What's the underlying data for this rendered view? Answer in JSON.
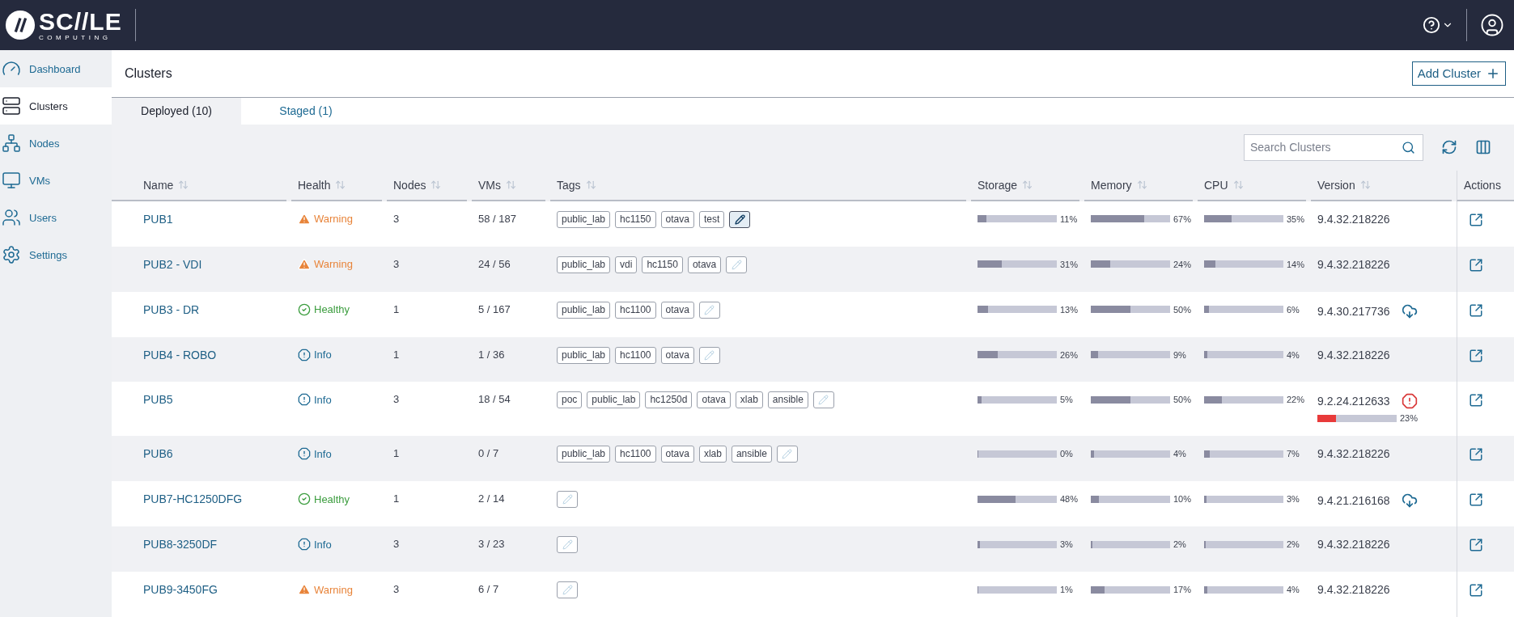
{
  "logo": {
    "name": "SC//LE",
    "tagline": "COMPUTING"
  },
  "sidebar": {
    "items": [
      {
        "label": "Dashboard",
        "selected": false
      },
      {
        "label": "Clusters",
        "selected": true
      },
      {
        "label": "Nodes",
        "selected": false
      },
      {
        "label": "VMs",
        "selected": false
      },
      {
        "label": "Users",
        "selected": false
      },
      {
        "label": "Settings",
        "selected": false
      }
    ]
  },
  "page": {
    "title": "Clusters",
    "add_button": "Add Cluster"
  },
  "tabs": [
    {
      "label": "Deployed (10)",
      "selected": true
    },
    {
      "label": "Staged (1)",
      "selected": false
    }
  ],
  "search": {
    "placeholder": "Search Clusters"
  },
  "table": {
    "columns": [
      {
        "label": "Name",
        "sortable": true
      },
      {
        "label": "Health",
        "sortable": true
      },
      {
        "label": "Nodes",
        "sortable": true
      },
      {
        "label": "VMs",
        "sortable": true
      },
      {
        "label": "Tags",
        "sortable": true
      },
      {
        "label": "Storage",
        "sortable": true
      },
      {
        "label": "Memory",
        "sortable": true
      },
      {
        "label": "CPU",
        "sortable": true
      },
      {
        "label": "Version",
        "sortable": true
      },
      {
        "label": "Actions",
        "sortable": false
      }
    ],
    "rows": [
      {
        "name": "PUB1",
        "health": {
          "kind": "warning",
          "label": "Warning"
        },
        "nodes": "3",
        "vms": "58 / 187",
        "tags": [
          "public_lab",
          "hc1150",
          "otava",
          "test"
        ],
        "edit_highlighted": true,
        "storage": {
          "level": 0.11,
          "reading": "11%"
        },
        "memory": {
          "level": 0.67,
          "reading": "67%"
        },
        "cpu": {
          "level": 0.35,
          "reading": "35%"
        },
        "version": {
          "text": "9.4.32.218226",
          "kind": "plain"
        }
      },
      {
        "name": "PUB2 - VDI",
        "health": {
          "kind": "warning",
          "label": "Warning"
        },
        "nodes": "3",
        "vms": "24 / 56",
        "tags": [
          "public_lab",
          "vdi",
          "hc1150",
          "otava"
        ],
        "edit_highlighted": false,
        "storage": {
          "level": 0.31,
          "reading": "31%"
        },
        "memory": {
          "level": 0.24,
          "reading": "24%"
        },
        "cpu": {
          "level": 0.14,
          "reading": "14%"
        },
        "version": {
          "text": "9.4.32.218226",
          "kind": "plain"
        }
      },
      {
        "name": "PUB3 - DR",
        "health": {
          "kind": "healthy",
          "label": "Healthy"
        },
        "nodes": "1",
        "vms": "5 / 167",
        "tags": [
          "public_lab",
          "hc1100",
          "otava"
        ],
        "edit_highlighted": false,
        "storage": {
          "level": 0.13,
          "reading": "13%"
        },
        "memory": {
          "level": 0.5,
          "reading": "50%"
        },
        "cpu": {
          "level": 0.06,
          "reading": "6%"
        },
        "version": {
          "text": "9.4.30.217736",
          "kind": "update"
        }
      },
      {
        "name": "PUB4 - ROBO",
        "health": {
          "kind": "info",
          "label": "Info"
        },
        "nodes": "1",
        "vms": "1 / 36",
        "tags": [
          "public_lab",
          "hc1100",
          "otava"
        ],
        "edit_highlighted": false,
        "storage": {
          "level": 0.26,
          "reading": "26%"
        },
        "memory": {
          "level": 0.09,
          "reading": "9%"
        },
        "cpu": {
          "level": 0.04,
          "reading": "4%"
        },
        "version": {
          "text": "9.4.32.218226",
          "kind": "plain"
        }
      },
      {
        "name": "PUB5",
        "health": {
          "kind": "info",
          "label": "Info"
        },
        "nodes": "3",
        "vms": "18 / 54",
        "tags": [
          "poc",
          "public_lab",
          "hc1250d",
          "otava",
          "xlab",
          "ansible"
        ],
        "edit_highlighted": false,
        "storage": {
          "level": 0.05,
          "reading": "5%"
        },
        "memory": {
          "level": 0.5,
          "reading": "50%"
        },
        "cpu": {
          "level": 0.22,
          "reading": "22%"
        },
        "version": {
          "text": "9.2.24.212633",
          "kind": "upgrading",
          "progress": {
            "level": 0.23,
            "reading": "23%"
          }
        }
      },
      {
        "name": "PUB6",
        "health": {
          "kind": "info",
          "label": "Info"
        },
        "nodes": "1",
        "vms": "0 / 7",
        "tags": [
          "public_lab",
          "hc1100",
          "otava",
          "xlab",
          "ansible"
        ],
        "edit_highlighted": false,
        "storage": {
          "level": 0,
          "reading": "0%"
        },
        "memory": {
          "level": 0.04,
          "reading": "4%"
        },
        "cpu": {
          "level": 0.07,
          "reading": "7%"
        },
        "version": {
          "text": "9.4.32.218226",
          "kind": "plain"
        }
      },
      {
        "name": "PUB7-HC1250DFG",
        "health": {
          "kind": "healthy",
          "label": "Healthy"
        },
        "nodes": "1",
        "vms": "2 / 14",
        "tags": [],
        "edit_highlighted": false,
        "storage": {
          "level": 0.48,
          "reading": "48%"
        },
        "memory": {
          "level": 0.1,
          "reading": "10%"
        },
        "cpu": {
          "level": 0.03,
          "reading": "3%"
        },
        "version": {
          "text": "9.4.21.216168",
          "kind": "update"
        }
      },
      {
        "name": "PUB8-3250DF",
        "health": {
          "kind": "info",
          "label": "Info"
        },
        "nodes": "3",
        "vms": "3 / 23",
        "tags": [],
        "edit_highlighted": false,
        "storage": {
          "level": 0.03,
          "reading": "3%"
        },
        "memory": {
          "level": 0.02,
          "reading": "2%"
        },
        "cpu": {
          "level": 0.02,
          "reading": "2%"
        },
        "version": {
          "text": "9.4.32.218226",
          "kind": "plain"
        }
      },
      {
        "name": "PUB9-3450FG",
        "health": {
          "kind": "warning",
          "label": "Warning"
        },
        "nodes": "3",
        "vms": "6 / 7",
        "tags": [],
        "edit_highlighted": false,
        "storage": {
          "level": 0.01,
          "reading": "1%"
        },
        "memory": {
          "level": 0.17,
          "reading": "17%"
        },
        "cpu": {
          "level": 0.04,
          "reading": "4%"
        },
        "version": {
          "text": "9.4.32.218226",
          "kind": "plain"
        }
      }
    ]
  }
}
